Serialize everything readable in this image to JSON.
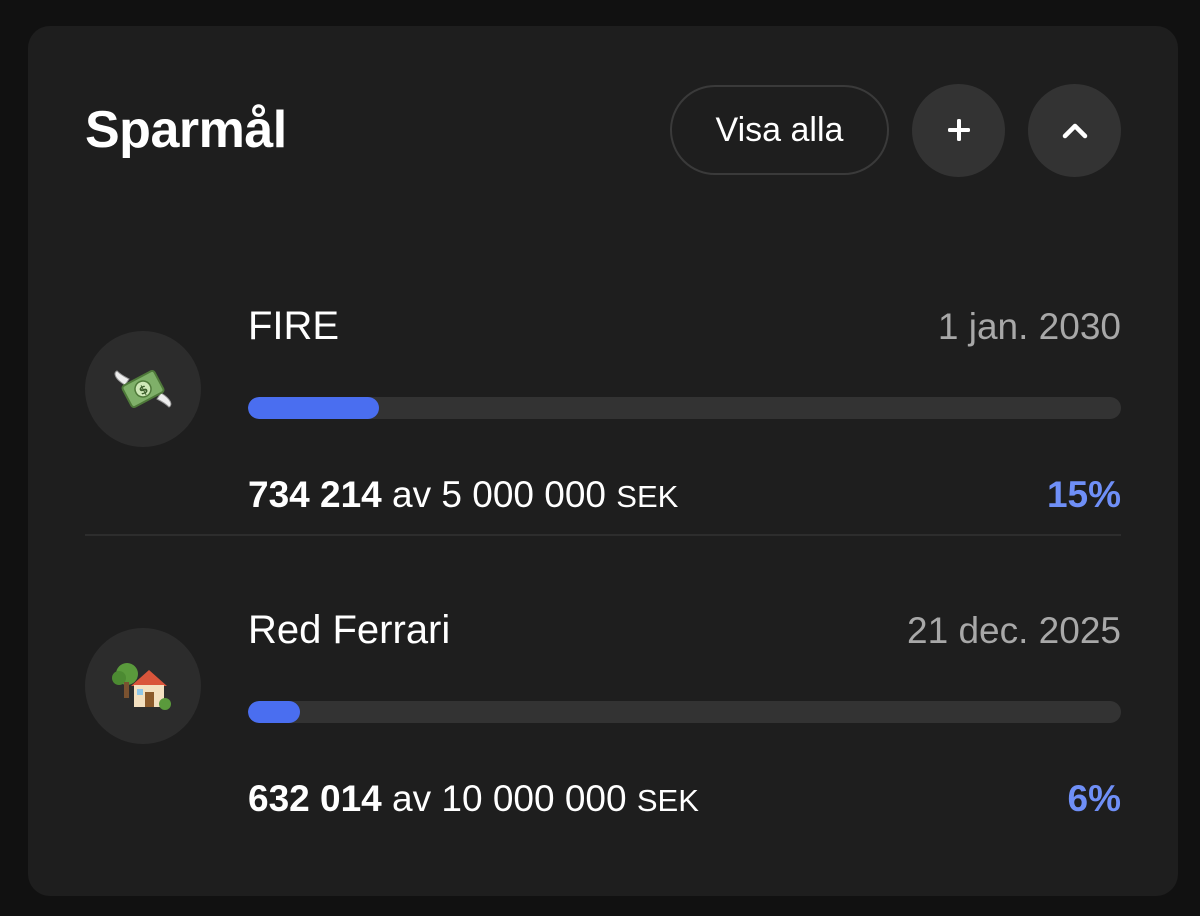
{
  "header": {
    "title": "Sparmål",
    "show_all_label": "Visa alla",
    "add_label": "+",
    "collapse_icon": "chevron-up-icon"
  },
  "goals": [
    {
      "icon": "money-with-wings-icon",
      "name": "FIRE",
      "date": "1 jan. 2030",
      "current": "734 214",
      "of_word": "av",
      "target": "5 000 000",
      "currency": "SEK",
      "percent": "15%",
      "progress": 0.15
    },
    {
      "icon": "house-with-garden-icon",
      "name": "Red Ferrari",
      "date": "21 dec. 2025",
      "current": "632 014",
      "of_word": "av",
      "target": "10 000 000",
      "currency": "SEK",
      "percent": "6%",
      "progress": 0.06
    }
  ],
  "colors": {
    "accent": "#4a6ef0",
    "percent": "#6f8ff7",
    "card": "#1e1e1e",
    "background": "#111111"
  }
}
